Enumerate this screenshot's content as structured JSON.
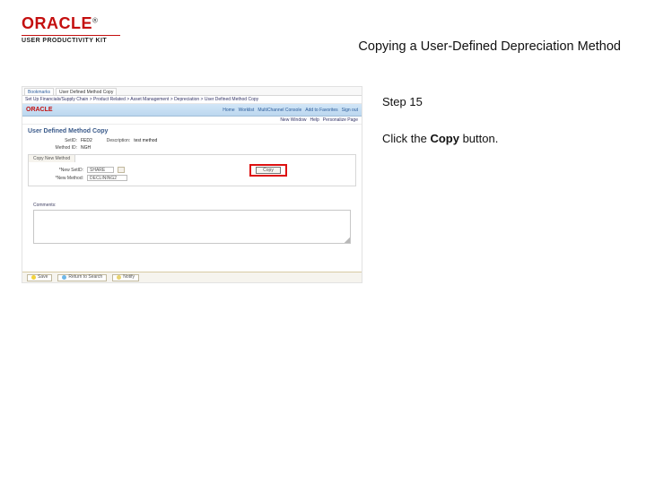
{
  "header": {
    "brand": "ORACLE",
    "tm": "®",
    "product_line": "USER PRODUCTIVITY KIT",
    "title": "Copying a User-Defined Depreciation Method"
  },
  "side": {
    "step": "Step 15",
    "instruction_pre": "Click the ",
    "instruction_bold": "Copy",
    "instruction_post": " button."
  },
  "mock": {
    "tabs": [
      "Bookmarks",
      "User Defined Method Copy"
    ],
    "crumb": "Set Up Financials/Supply Chain > Product Related > Asset Management > Depreciation > User Defined Method Copy",
    "ribbon": {
      "brand": "ORACLE",
      "links": [
        "Home",
        "Worklist",
        "MultiChannel Console",
        "Add to Favorites",
        "Sign out"
      ]
    },
    "subhead": [
      "New Window",
      "Help",
      "Personalize Page"
    ],
    "page_title": "User Defined Method Copy",
    "fields": {
      "setid_label": "SetID:",
      "setid_value": "FED2",
      "method_label": "Method ID:",
      "method_value": "NGH",
      "description_label": "Description:",
      "description_value": "test method"
    },
    "section": {
      "tab": "Copy New Method",
      "new_setid_label": "*New SetID:",
      "new_setid_value": "SHARE",
      "new_method_label": "*New Method:",
      "new_method_value": "DECLINING2"
    },
    "copy_button": "Copy",
    "comments_label": "Comments:",
    "bottom_buttons": {
      "save": "Save",
      "return": "Return to Search",
      "notify": "Notify"
    }
  }
}
